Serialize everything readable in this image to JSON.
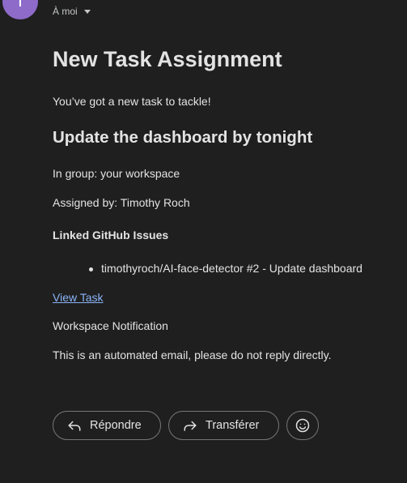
{
  "header": {
    "avatar_letter": "T",
    "avatar_color": "#8e6bc9",
    "recipient_label": "À moi"
  },
  "email": {
    "title": "New Task Assignment",
    "intro": "You’ve got a new task to tackle!",
    "task_title": "Update the dashboard by tonight",
    "group_line": "In group: your workspace",
    "assigned_line": "Assigned by: Timothy Roch",
    "issues_heading": "Linked GitHub Issues",
    "issues": [
      "timothyroch/AI-face-detector #2 - Update dashboard"
    ],
    "view_task_link": "View Task",
    "notification_line": "Workspace Notification",
    "automated_line": "This is an automated email, please do not reply directly."
  },
  "actions": {
    "reply_label": "Répondre",
    "forward_label": "Transférer",
    "reply_icon": "reply-icon",
    "forward_icon": "forward-icon",
    "emoji_icon": "emoji-icon"
  },
  "colors": {
    "background": "#1f1f1f",
    "text": "#e3e3e3",
    "link": "#8ab4f8",
    "button_border": "#747775"
  }
}
